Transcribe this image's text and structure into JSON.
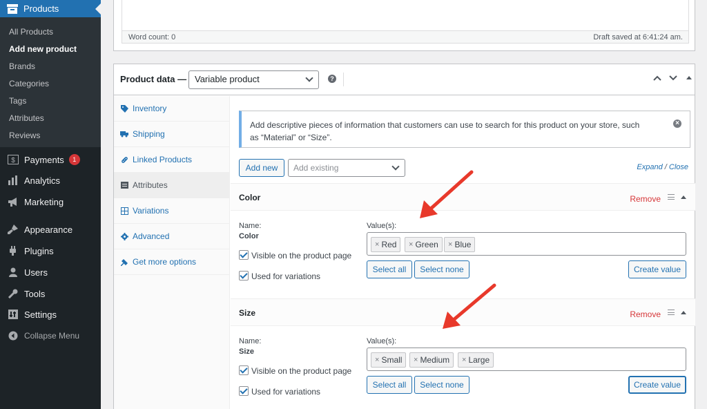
{
  "sidebar": {
    "current": "Products",
    "submenu": [
      "All Products",
      "Add new product",
      "Brands",
      "Categories",
      "Tags",
      "Attributes",
      "Reviews"
    ],
    "submenu_current": "Add new product",
    "items": [
      {
        "label": "Payments",
        "icon": "payments-icon",
        "badge": "1"
      },
      {
        "label": "Analytics",
        "icon": "analytics-icon"
      },
      {
        "label": "Marketing",
        "icon": "megaphone-icon"
      },
      {
        "label": "Appearance",
        "icon": "brush-icon"
      },
      {
        "label": "Plugins",
        "icon": "plugin-icon"
      },
      {
        "label": "Users",
        "icon": "users-icon"
      },
      {
        "label": "Tools",
        "icon": "wrench-icon"
      },
      {
        "label": "Settings",
        "icon": "settings-icon"
      }
    ],
    "collapse": "Collapse Menu"
  },
  "editor": {
    "word_count": "Word count: 0",
    "draft_saved": "Draft saved at 6:41:24 am."
  },
  "product_data": {
    "title": "Product data —",
    "type": "Variable product",
    "tabs": [
      {
        "label": "Inventory",
        "icon": "tag-icon"
      },
      {
        "label": "Shipping",
        "icon": "truck-icon"
      },
      {
        "label": "Linked Products",
        "icon": "link-icon"
      },
      {
        "label": "Attributes",
        "icon": "list-icon",
        "active": true
      },
      {
        "label": "Variations",
        "icon": "grid-icon"
      },
      {
        "label": "Advanced",
        "icon": "gear-icon"
      },
      {
        "label": "Get more options",
        "icon": "plug-icon"
      }
    ]
  },
  "attributes": {
    "notice": "Add descriptive pieces of information that customers can use to search for this product on your store, such as “Material” or “Size”.",
    "add_new": "Add new",
    "add_existing_placeholder": "Add existing",
    "expand": "Expand",
    "separator": "/",
    "close": "Close",
    "name_label": "Name:",
    "values_label": "Value(s):",
    "visible_label": "Visible on the product page",
    "variations_label": "Used for variations",
    "remove": "Remove",
    "select_all": "Select all",
    "select_none": "Select none",
    "create_value": "Create value",
    "list": [
      {
        "name": "Color",
        "values": [
          "Red",
          "Green",
          "Blue"
        ]
      },
      {
        "name": "Size",
        "values": [
          "Small",
          "Medium",
          "Large"
        ]
      }
    ]
  },
  "colors": {
    "sidebar_bg": "#1d2327",
    "accent": "#2271b1",
    "remove_red": "#d63638",
    "annotation_red": "#e8392b"
  }
}
